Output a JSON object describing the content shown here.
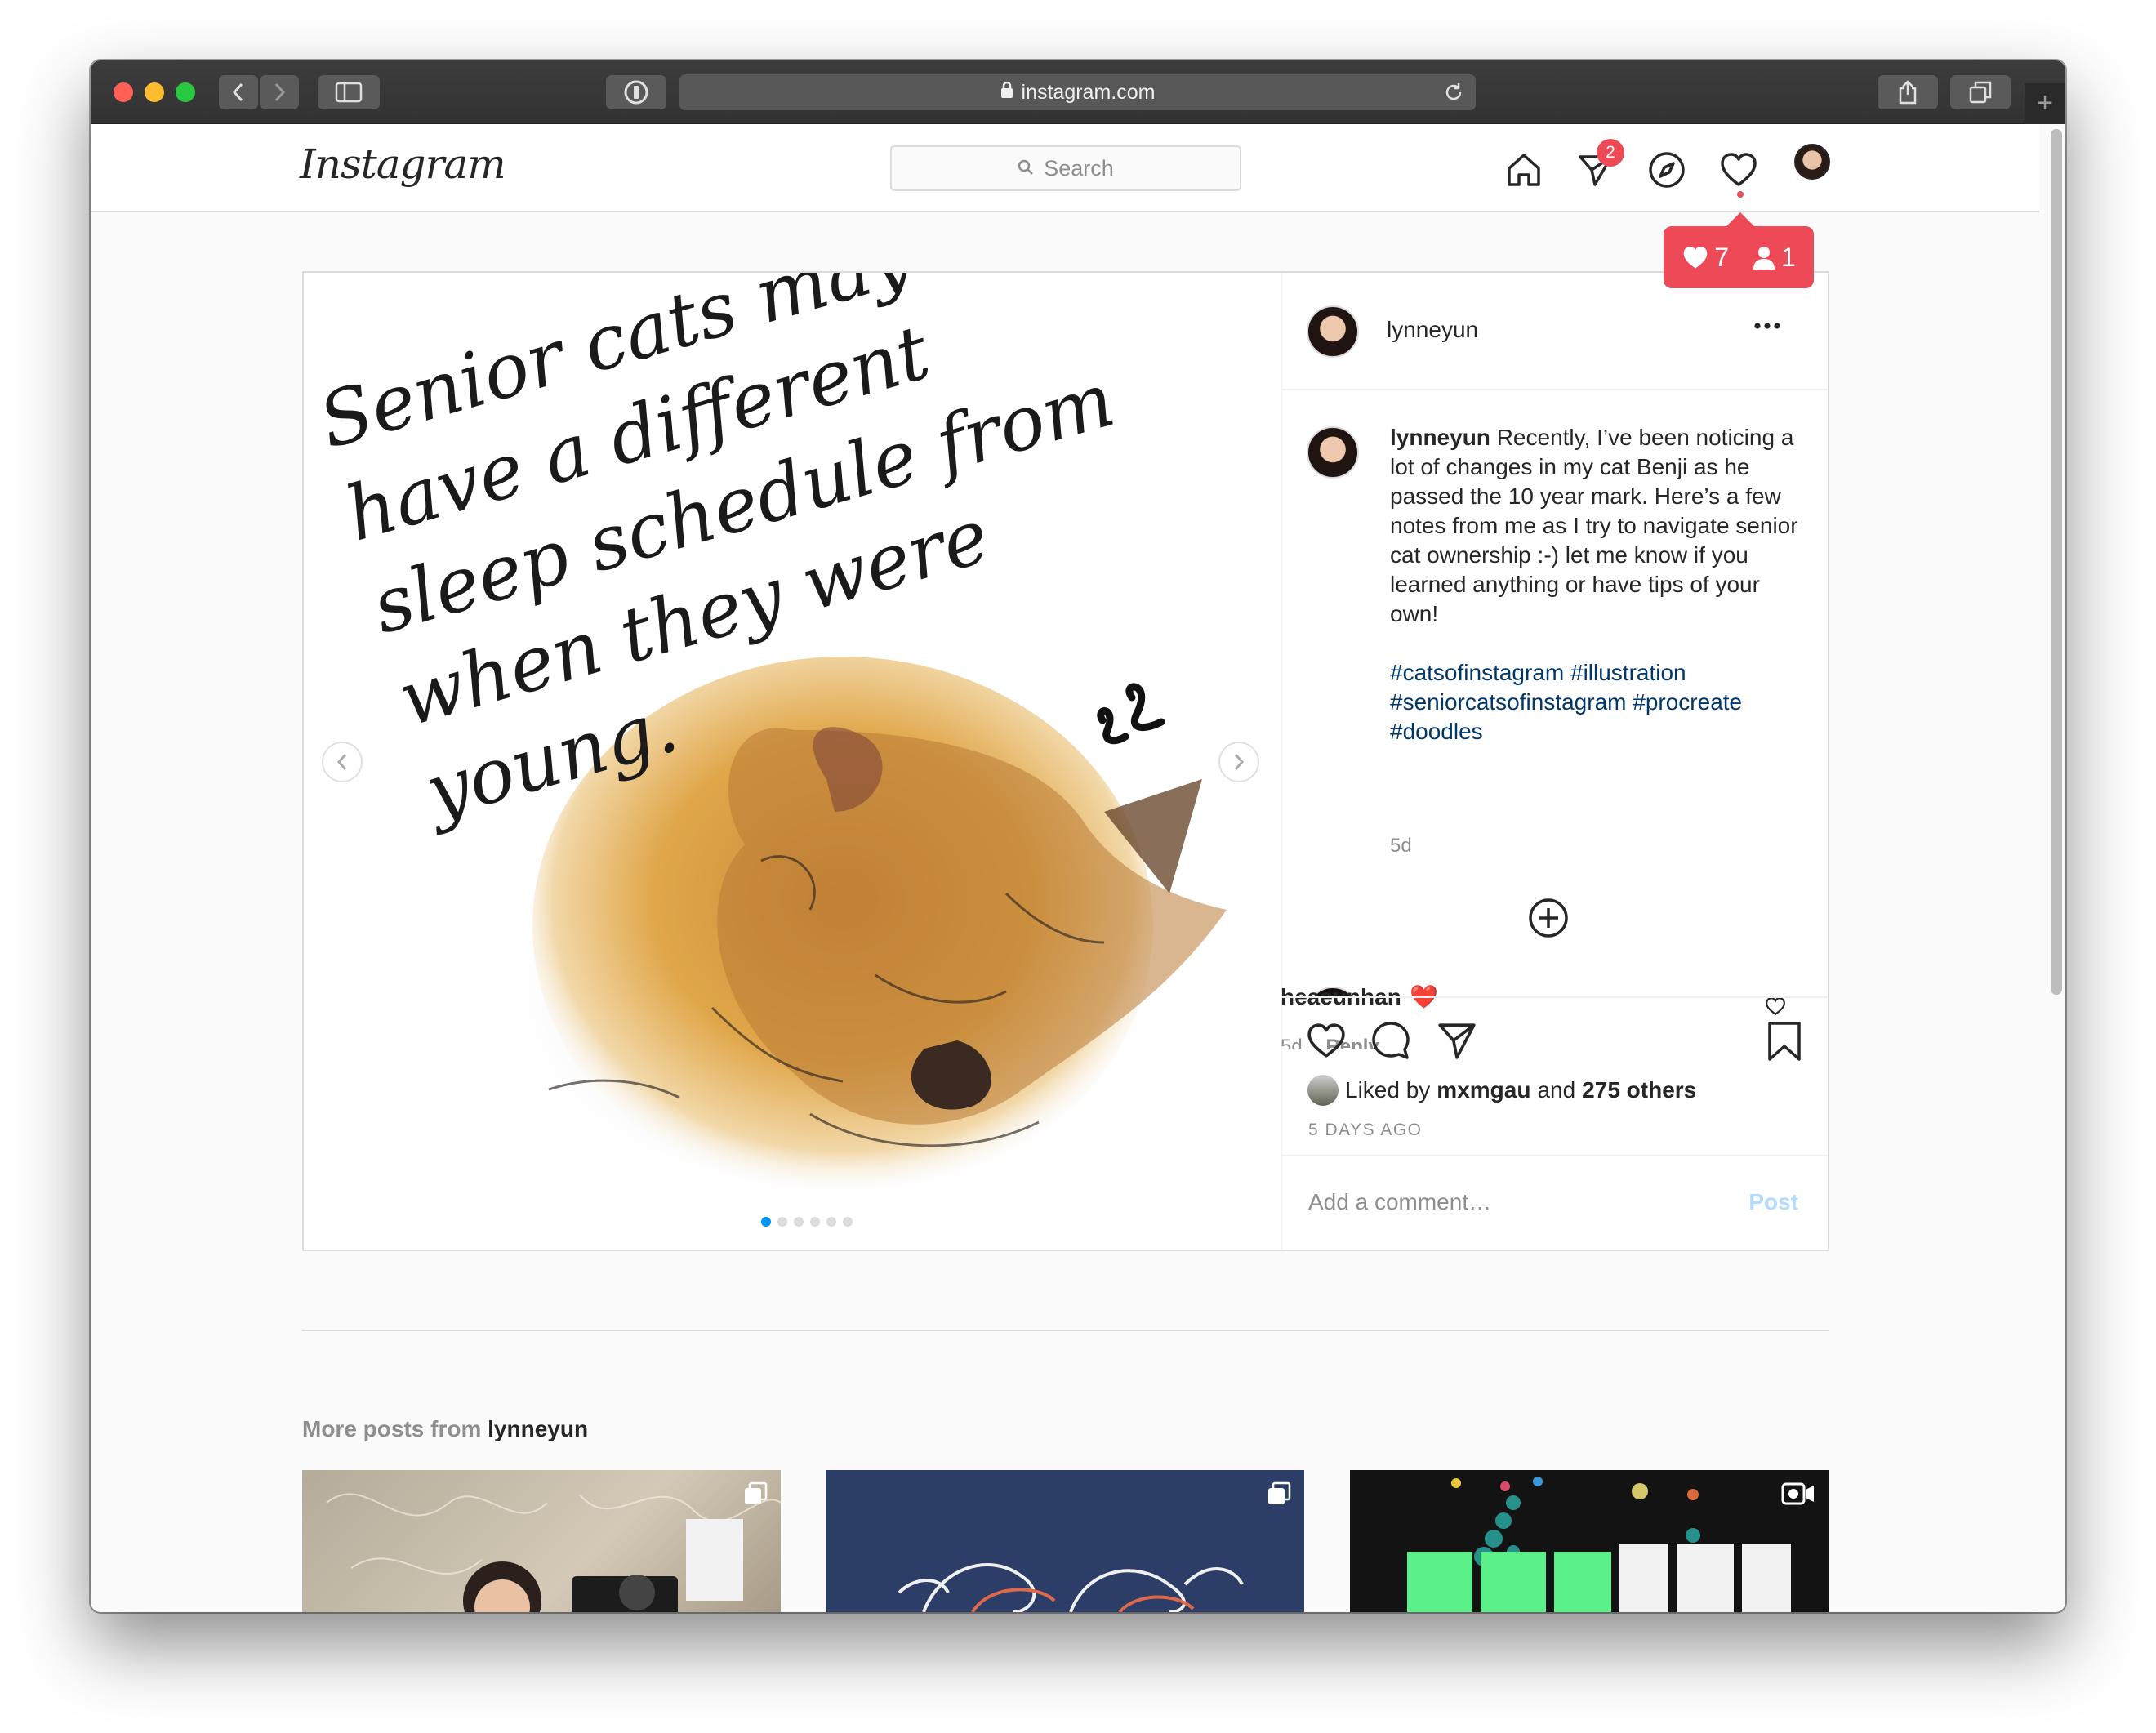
{
  "browser": {
    "url": "instagram.com"
  },
  "header": {
    "logo": "Instagram",
    "search_placeholder": "Search",
    "dm_badge_count": "2",
    "notifications": {
      "likes": "7",
      "follows": "1"
    }
  },
  "post": {
    "image_text": "Senior cats may have a different sleep schedule from when they were young.",
    "username": "lynneyun",
    "caption_username": "lynneyun",
    "caption_text": "Recently, I’ve been noticing a lot of changes in my cat Benji as he passed the 10 year mark. Here’s a few notes from me as I try to navigate senior cat ownership :-) let me know if you learned anything or have tips of your own!",
    "hashtags": "#catsofinstagram #illustration #seniorcatsofinstagram #procreate #doodles",
    "time": "5d",
    "carousel_count": 6,
    "carousel_active": 0,
    "comment": {
      "username": "heaeunhan",
      "emoji": "❤️",
      "time": "5d",
      "reply_label": "Reply"
    },
    "likes": {
      "prefix": "Liked by",
      "user": "mxmgau",
      "joiner": "and",
      "others": "275 others"
    },
    "days_ago": "5 DAYS AGO",
    "comment_placeholder": "Add a comment…",
    "post_button": "Post"
  },
  "more_posts": {
    "label": "More posts from",
    "username": "lynneyun"
  },
  "colors": {
    "accent_red": "#ed4956",
    "link_blue": "#00376b",
    "post_button": "#b3dbff"
  }
}
